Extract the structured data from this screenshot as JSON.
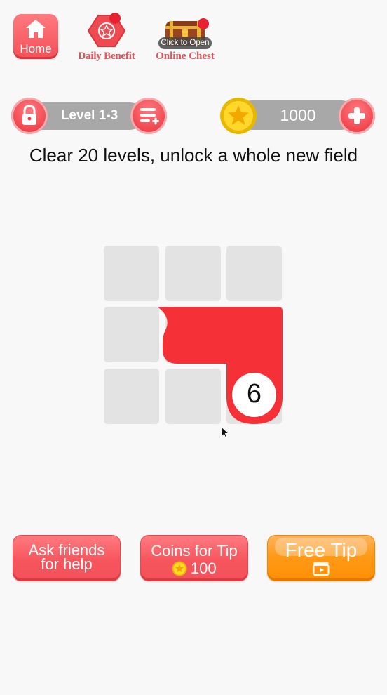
{
  "top_bar": {
    "home_label": "Home",
    "daily_label": "Daily Benefit",
    "chest_label": "Online Chest",
    "chest_hint": "Click to Open"
  },
  "level": {
    "label": "Level 1-3"
  },
  "coins": {
    "amount": "1000"
  },
  "subtitle": "Clear 20 levels, unlock a whole new field",
  "board": {
    "rows": 3,
    "cols": 3,
    "path_color": "#f53036",
    "path_end_number": "6"
  },
  "buttons": {
    "ask_friends_line1": "Ask friends",
    "ask_friends_line2": "for help",
    "coins_tip_line1": "Coins for Tip",
    "coins_tip_cost": "100",
    "free_tip_label": "Free Tip"
  },
  "colors": {
    "accent_red": "#f4525a",
    "accent_orange": "#ff9a17",
    "grid_cell": "#e3e3e3",
    "bar_gray": "#a8a8a8"
  },
  "icons": {
    "home": "home-icon",
    "daily": "star-hexagon-icon",
    "chest": "treasure-chest-icon",
    "lock": "lock-icon",
    "level_menu": "list-add-icon",
    "coin": "coin-star-icon",
    "add_coins": "plus-icon",
    "video": "video-clapper-icon"
  }
}
